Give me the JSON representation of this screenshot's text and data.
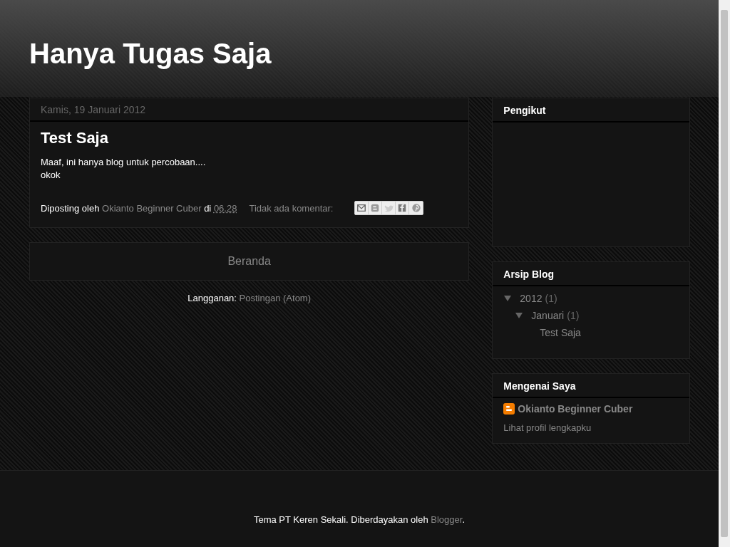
{
  "blog_title": "Hanya Tugas Saja",
  "post": {
    "date": "Kamis, 19 Januari 2012",
    "title": "Test Saja",
    "body": [
      "Maaf, ini hanya blog untuk percobaan....",
      "okok"
    ],
    "byline": {
      "prefix": "Diposting oleh",
      "author": "Okianto Beginner Cuber",
      "at": "di",
      "time": "06.28"
    },
    "comments": "Tidak ada komentar:",
    "share": [
      {
        "kind": "email"
      },
      {
        "kind": "blog"
      },
      {
        "kind": "twitter"
      },
      {
        "kind": "facebook"
      },
      {
        "kind": "pinterest"
      }
    ]
  },
  "home_link": "Beranda",
  "subscribe": {
    "label": "Langganan:",
    "link": "Postingan (Atom)"
  },
  "sidebar": {
    "followers": {
      "title": "Pengikut"
    },
    "archive": {
      "title": "Arsip Blog",
      "items": [
        {
          "label": "2012",
          "count": "(1)",
          "expanded": true,
          "children": [
            {
              "label": "Januari",
              "count": "(1)",
              "expanded": true,
              "children": [
                {
                  "label": "Test Saja"
                }
              ]
            }
          ]
        }
      ]
    },
    "about": {
      "title": "Mengenai Saya",
      "name": "Okianto Beginner Cuber",
      "profile_link": "Lihat profil lengkapku"
    }
  },
  "footer": {
    "text": "Tema PT Keren Sekali. Diberdayakan oleh",
    "link": "Blogger",
    "end": "."
  }
}
